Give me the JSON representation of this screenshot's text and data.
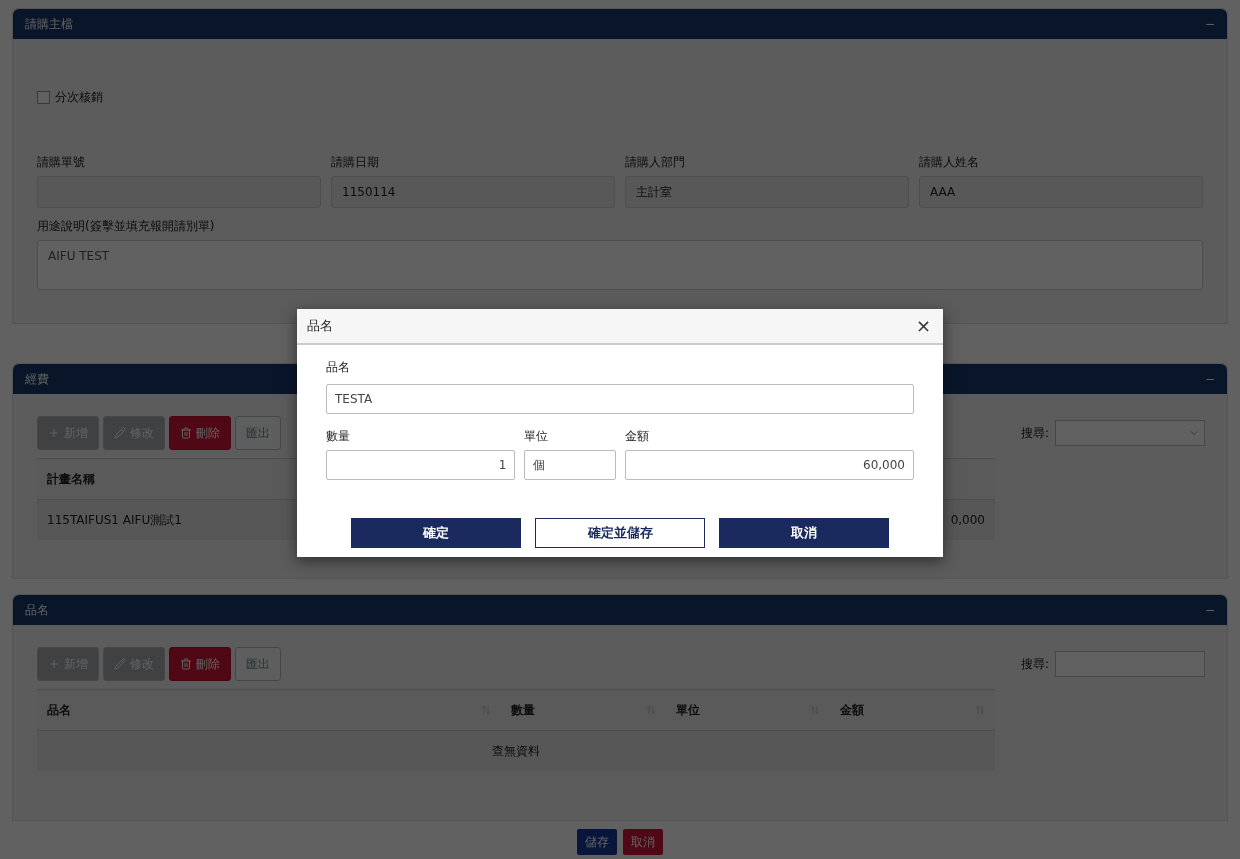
{
  "main_panel": {
    "title": "請購主檔",
    "collapse": "−",
    "split_checkbox": {
      "label": "分次核銷",
      "checked": false
    },
    "fields": [
      {
        "label": "請購單號"
      },
      {
        "label": "請購日期",
        "value": "1150114"
      },
      {
        "label": "請購人部門",
        "value": "主計室"
      },
      {
        "label": "請購人姓名",
        "value": "AAA"
      }
    ],
    "purpose": {
      "label": "用途說明(簽擊並填充報開請別單)",
      "value": "AIFU TEST"
    }
  },
  "funding_panel": {
    "title": "經費",
    "collapse": "−",
    "toolbar": [
      {
        "kind": "add",
        "label": "新增",
        "disabled": false
      },
      {
        "kind": "edit",
        "label": "修改",
        "disabled": false
      },
      {
        "kind": "delete",
        "label": "刪除",
        "disabled": false
      },
      {
        "kind": "export",
        "label": "匯出",
        "disabled": true
      }
    ],
    "search": {
      "label": "搜尋:",
      "kind": "select"
    },
    "columns": [
      "計畫名稱"
    ],
    "rows": [
      {
        "cells": [
          "115TAIFUS1 AIFU測試1",
          "0,000"
        ]
      }
    ]
  },
  "items_panel": {
    "title": "品名",
    "collapse": "−",
    "toolbar": [
      {
        "kind": "add",
        "label": "新增",
        "disabled": false
      },
      {
        "kind": "edit",
        "label": "修改",
        "disabled": false
      },
      {
        "kind": "delete",
        "label": "刪除",
        "disabled": false
      },
      {
        "kind": "export",
        "label": "匯出",
        "disabled": true
      }
    ],
    "search": {
      "label": "搜尋:",
      "kind": "input"
    },
    "columns": [
      "品名",
      "數量",
      "單位",
      "金額"
    ],
    "empty": "查無資料"
  },
  "footer_buttons": [
    {
      "kind": "primary",
      "label": "儲存"
    },
    {
      "kind": "danger",
      "label": "取消"
    }
  ],
  "dialog": {
    "title": "品名",
    "close": "×",
    "name": {
      "label": "品名",
      "value": "TESTA"
    },
    "fields": [
      {
        "label": "數量",
        "value": "1"
      },
      {
        "label": "單位",
        "value": "個"
      },
      {
        "label": "金額",
        "value": "60,000"
      }
    ],
    "buttons": [
      {
        "kind": "primary",
        "label": "確定"
      },
      {
        "kind": "outline",
        "label": "確定並儲存"
      },
      {
        "kind": "primary",
        "label": "取消"
      }
    ]
  }
}
